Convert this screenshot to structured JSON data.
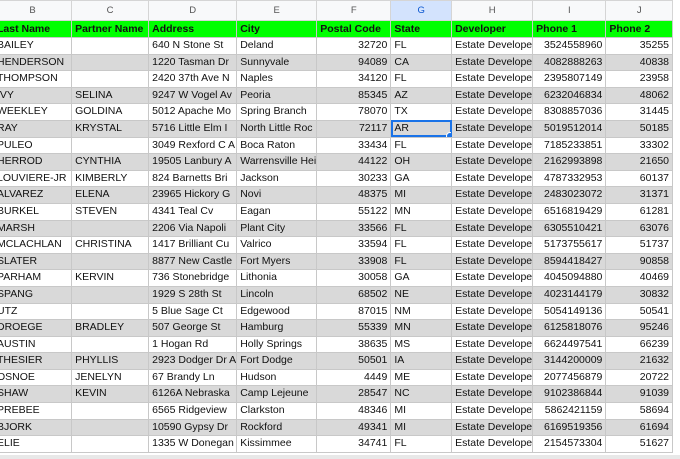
{
  "columns": [
    "B",
    "C",
    "D",
    "E",
    "F",
    "G",
    "H",
    "I",
    "J"
  ],
  "active_column": "G",
  "headers": [
    "Last Name",
    "Partner Name",
    "Address",
    "City",
    "Postal Code",
    "State",
    "Developer",
    "Phone 1",
    "Phone 2"
  ],
  "selected": {
    "row": 5,
    "col": 5
  },
  "rows": [
    {
      "shaded": false,
      "cells": [
        "BAILEY",
        "",
        "640 N Stone St",
        "Deland",
        "32720",
        "FL",
        "Estate Develope",
        "3524558960",
        "35255"
      ]
    },
    {
      "shaded": true,
      "cells": [
        "HENDERSON",
        "",
        "1220 Tasman Dr",
        "Sunnyvale",
        "94089",
        "CA",
        "Estate Develope",
        "4082888263",
        "40838"
      ]
    },
    {
      "shaded": false,
      "cells": [
        "THOMPSON",
        "",
        "2420 37th Ave N",
        "Naples",
        "34120",
        "FL",
        "Estate Develope",
        "2395807149",
        "23958"
      ]
    },
    {
      "shaded": true,
      "cells": [
        "IVY",
        "SELINA",
        "9247 W Vogel Av",
        "Peoria",
        "85345",
        "AZ",
        "Estate Develope",
        "6232046834",
        "48062"
      ]
    },
    {
      "shaded": false,
      "cells": [
        "WEEKLEY",
        "GOLDINA",
        "5012 Apache Mo",
        "Spring Branch",
        "78070",
        "TX",
        "Estate Develope",
        "8308857036",
        "31445"
      ]
    },
    {
      "shaded": true,
      "cells": [
        "RAY",
        "KRYSTAL",
        "5716 Little Elm I",
        "North Little Roc",
        "72117",
        "AR",
        "Estate Develope",
        "5019512014",
        "50185"
      ]
    },
    {
      "shaded": false,
      "cells": [
        "PULEO",
        "",
        "3049 Rexford C A",
        "Boca Raton",
        "33434",
        "FL",
        "Estate Develope",
        "7185233851",
        "33302"
      ]
    },
    {
      "shaded": true,
      "cells": [
        "HERROD",
        "CYNTHIA",
        "19505 Lanbury A",
        "Warrensville Hei",
        "44122",
        "OH",
        "Estate Develope",
        "2162993898",
        "21650"
      ]
    },
    {
      "shaded": false,
      "cells": [
        "LOUVIERE-JR",
        "KIMBERLY",
        "824 Barnetts Bri",
        "Jackson",
        "30233",
        "GA",
        "Estate Develope",
        "4787332953",
        "60137"
      ]
    },
    {
      "shaded": true,
      "cells": [
        "ALVAREZ",
        "ELENA",
        "23965 Hickory G",
        "Novi",
        "48375",
        "MI",
        "Estate Develope",
        "2483023072",
        "31371"
      ]
    },
    {
      "shaded": false,
      "cells": [
        "BURKEL",
        "STEVEN",
        "4341 Teal Cv",
        "Eagan",
        "55122",
        "MN",
        "Estate Develope",
        "6516819429",
        "61281"
      ]
    },
    {
      "shaded": true,
      "cells": [
        "MARSH",
        "",
        "2206 Via Napoli",
        "Plant City",
        "33566",
        "FL",
        "Estate Develope",
        "6305510421",
        "63076"
      ]
    },
    {
      "shaded": false,
      "cells": [
        "MCLACHLAN",
        "CHRISTINA",
        "1417 Brilliant Cu",
        "Valrico",
        "33594",
        "FL",
        "Estate Develope",
        "5173755617",
        "51737"
      ]
    },
    {
      "shaded": true,
      "cells": [
        "SLATER",
        "",
        "8877 New Castle",
        "Fort Myers",
        "33908",
        "FL",
        "Estate Develope",
        "8594418427",
        "90858"
      ]
    },
    {
      "shaded": false,
      "cells": [
        "PARHAM",
        "KERVIN",
        "736 Stonebridge",
        "Lithonia",
        "30058",
        "GA",
        "Estate Develope",
        "4045094880",
        "40469"
      ]
    },
    {
      "shaded": true,
      "cells": [
        "SPANG",
        "",
        "1929 S 28th St",
        "Lincoln",
        "68502",
        "NE",
        "Estate Develope",
        "4023144179",
        "30832"
      ]
    },
    {
      "shaded": false,
      "cells": [
        "UTZ",
        "",
        "5 Blue Sage Ct",
        "Edgewood",
        "87015",
        "NM",
        "Estate Develope",
        "5054149136",
        "50541"
      ]
    },
    {
      "shaded": true,
      "cells": [
        "DROEGE",
        "BRADLEY",
        "507 George St",
        "Hamburg",
        "55339",
        "MN",
        "Estate Develope",
        "6125818076",
        "95246"
      ]
    },
    {
      "shaded": false,
      "cells": [
        "AUSTIN",
        "",
        "1 Hogan Rd",
        "Holly Springs",
        "38635",
        "MS",
        "Estate Develope",
        "6624497541",
        "66239"
      ]
    },
    {
      "shaded": true,
      "cells": [
        "THESIER",
        "PHYLLIS",
        "2923 Dodger Dr A",
        "Fort Dodge",
        "50501",
        "IA",
        "Estate Develope",
        "3144200009",
        "21632"
      ]
    },
    {
      "shaded": false,
      "cells": [
        "OSNOE",
        "JENELYN",
        "67 Brandy Ln",
        "Hudson",
        "4449",
        "ME",
        "Estate Develope",
        "2077456879",
        "20722"
      ]
    },
    {
      "shaded": true,
      "cells": [
        "SHAW",
        "KEVIN",
        "6126A Nebraska",
        "Camp Lejeune",
        "28547",
        "NC",
        "Estate Develope",
        "9102386844",
        "91039"
      ]
    },
    {
      "shaded": false,
      "cells": [
        "PREBEE",
        "",
        "6565 Ridgeview",
        "Clarkston",
        "48346",
        "MI",
        "Estate Develope",
        "5862421159",
        "58694"
      ]
    },
    {
      "shaded": true,
      "cells": [
        "BJORK",
        "",
        "10590 Gypsy Dr",
        "Rockford",
        "49341",
        "MI",
        "Estate Develope",
        "6169519356",
        "61694"
      ]
    },
    {
      "shaded": false,
      "cells": [
        "ELIE",
        "",
        "1335 W Donegan",
        "Kissimmee",
        "34741",
        "FL",
        "Estate Develope",
        "2154573304",
        "51627"
      ]
    }
  ]
}
